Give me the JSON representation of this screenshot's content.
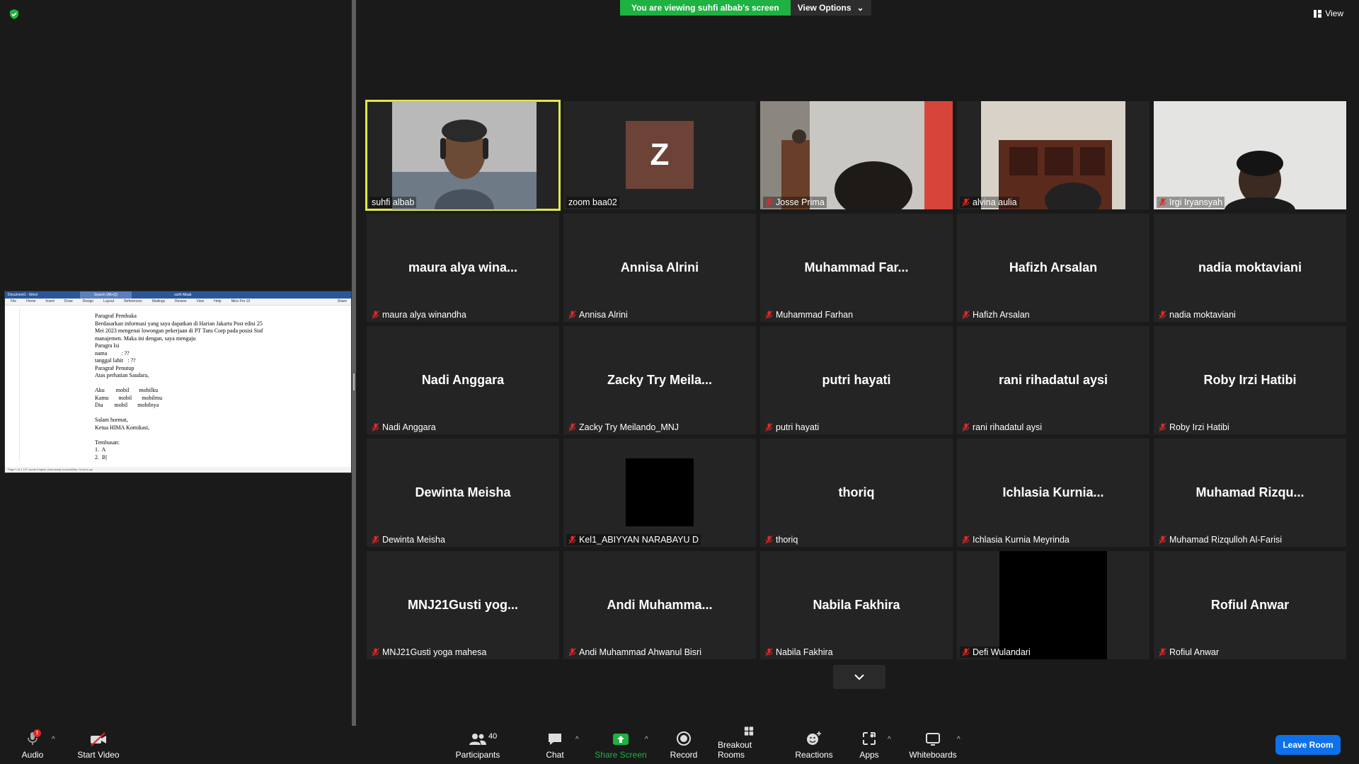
{
  "banner": {
    "viewing": "You are viewing suhfi albab's screen",
    "view_options": "View Options"
  },
  "view_button": "View",
  "shared_doc": {
    "title": "Document1 - Word",
    "search": "Search (Alt+Q)",
    "user": "suhfi Albab",
    "ribbon": [
      "File",
      "Home",
      "Insert",
      "Draw",
      "Design",
      "Layout",
      "References",
      "Mailings",
      "Review",
      "View",
      "Help",
      "Nitro Pro 10"
    ],
    "share": "Share",
    "lines": [
      "Paragraf Pembuka",
      "Berdasarkan informasi yang saya dapatkan di Harian Jakarta Post edisi 25",
      "Mei 2023 mengenai lowongan pekerjaan di PT Tans Corp pada posisi Staf",
      "manajemen. Maka ini dengan, saya mengaju",
      "Paragra Isi",
      "nama          : ??",
      "tanggal lahir   : ??",
      "Paragraf Penutup",
      "Atas perhatian Saudara,",
      "",
      "Aku        mobil       mobilku",
      "Kamu       mobil       mobilmu",
      "Dia        mobil       mobilnya",
      "",
      "Salam hormat,",
      "Ketua HIMA Komikasi,",
      "",
      "Tembusan:",
      "1.  A",
      "2.  B|"
    ],
    "status": "Page 1 of 1   127 words   English (Indonesia)   Accessibility: Good to go"
  },
  "participants": [
    {
      "big": "",
      "label": "suhfi albab",
      "muted": false,
      "video": "face1",
      "active": true
    },
    {
      "big": "",
      "label": "zoom baa02",
      "muted": false,
      "video": "avatar",
      "avatar_letter": "Z"
    },
    {
      "big": "",
      "label": "Josse Prima",
      "muted": true,
      "video": "room1"
    },
    {
      "big": "",
      "label": "alvina aulia",
      "muted": true,
      "video": "room2"
    },
    {
      "big": "",
      "label": "Irgi Iryansyah",
      "muted": true,
      "video": "room3"
    },
    {
      "big": "maura alya wina...",
      "label": "maura alya winandha",
      "muted": true
    },
    {
      "big": "Annisa Alrini",
      "label": "Annisa Alrini",
      "muted": true
    },
    {
      "big": "Muhammad  Far...",
      "label": "Muhammad Farhan",
      "muted": true
    },
    {
      "big": "Hafizh Arsalan",
      "label": "Hafizh Arsalan",
      "muted": true
    },
    {
      "big": "nadia moktaviani",
      "label": "nadia moktaviani",
      "muted": true
    },
    {
      "big": "Nadi Anggara",
      "label": "Nadi Anggara",
      "muted": true
    },
    {
      "big": "Zacky Try Meila...",
      "label": "Zacky Try Meilando_MNJ",
      "muted": true
    },
    {
      "big": "putri hayati",
      "label": "putri hayati",
      "muted": true
    },
    {
      "big": "rani rihadatul aysi",
      "label": "rani rihadatul aysi",
      "muted": true
    },
    {
      "big": "Roby Irzi Hatibi",
      "label": "Roby Irzi Hatibi",
      "muted": true
    },
    {
      "big": "Dewinta Meisha",
      "label": "Dewinta Meisha",
      "muted": true
    },
    {
      "big": "",
      "label": "Kel1_ABIYYAN NARABAYU D",
      "muted": true,
      "video": "black-box"
    },
    {
      "big": "thoriq",
      "label": "thoriq",
      "muted": true
    },
    {
      "big": "Ichlasia  Kurnia...",
      "label": "Ichlasia Kurnia Meyrinda",
      "muted": true
    },
    {
      "big": "Muhamad  Rizqu...",
      "label": "Muhamad Rizqulloh Al-Farisi",
      "muted": true
    },
    {
      "big": "MNJ21Gusti  yog...",
      "label": "MNJ21Gusti yoga mahesa",
      "muted": true
    },
    {
      "big": "Andi  Muhamma...",
      "label": "Andi Muhammad Ahwanul Bisri",
      "muted": true
    },
    {
      "big": "Nabila Fakhira",
      "label": "Nabila Fakhira",
      "muted": true
    },
    {
      "big": "",
      "label": "Defi Wulandari",
      "muted": true,
      "video": "black-full"
    },
    {
      "big": "Rofiul Anwar",
      "label": "Rofiul Anwar",
      "muted": true
    }
  ],
  "toolbar": {
    "audio": "Audio",
    "audio_badge": "!",
    "video": "Start Video",
    "participants": "Participants",
    "participants_count": "40",
    "chat": "Chat",
    "share": "Share Screen",
    "record": "Record",
    "breakout": "Breakout Rooms",
    "reactions": "Reactions",
    "apps": "Apps",
    "whiteboards": "Whiteboards",
    "leave": "Leave Room"
  },
  "colors": {
    "share_green": "#1fb141",
    "active_border": "#e1e84b",
    "leave_blue": "#0e71eb",
    "muted_red": "#e02828"
  }
}
